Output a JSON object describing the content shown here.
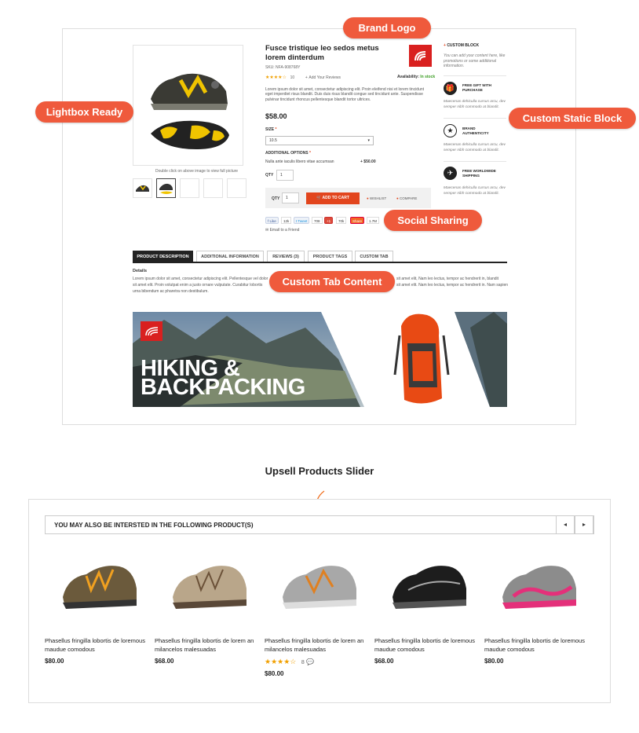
{
  "callouts": {
    "brand_logo": "Brand Logo",
    "lightbox": "Lightbox Ready",
    "static_block": "Custom Static Block",
    "social": "Social Sharing",
    "custom_tab": "Custom Tab Content",
    "upsell": "Upsell Products Slider"
  },
  "product": {
    "title": "Fusce tristique leo sedos metus lorem dinterdum",
    "sku": "SKU: NFA-908768Y",
    "rating_count": "10",
    "add_review": "Add Your Reviews",
    "availability_label": "Availability:",
    "availability": "In stock",
    "description": "Lorem ipsum dolor sit amet, consectetur adipiscing elit. Proin eleifend nisi et lorem tincidunt eget imperdiet risus blandit. Duis duis risus blandit congue sed tincidunt ante. Suspendisse pulvinar tincidunt rhoncus pellentesque blandit tortor ultrices.",
    "price": "$58.00",
    "size_label": "SIZE",
    "size_value": "10.5",
    "options_label": "ADDITIONAL OPTIONS",
    "option_text": "Nulla ante iaculis libero vitae accumsan",
    "option_price": "+ $50.00",
    "qty_label": "QTY",
    "qty_value": "1",
    "qty_value2": "1",
    "add_to_cart": "ADD TO CART",
    "wishlist": "WISHLIST",
    "compare": "COMPARE",
    "email_friend": "Email to a Friend",
    "image_note": "Double click on above image to view full picture"
  },
  "share": {
    "like": "Like",
    "like_count": "12k",
    "tweet": "Tweet",
    "tweet_count": "708",
    "gplus": "+1",
    "gplus_count": "70k",
    "sharebtn": "Share",
    "share_count": "1.7M"
  },
  "static_block": {
    "title": "CUSTOM BLOCK",
    "text": "You can add your content here, like promotions or some additional information.",
    "items": [
      {
        "title": "FREE GIFT WITH PURCHASE",
        "desc": "Maecenas dehiculla cursus arcu, dev semper nibh commodo at blandit."
      },
      {
        "title": "BRAND AUTHENTICITY",
        "desc": "Maecenas dehiculla cursus arcu, dev semper nibh commodo at blandit."
      },
      {
        "title": "FREE WORLDWIDE SHIPPING",
        "desc": "Maecenas dehiculla cursus arcu, dev semper nibh commodo at blandit."
      }
    ]
  },
  "tabs": [
    "PRODUCT DESCRIPTION",
    "ADDITIONAL INFORMATION",
    "REVIEWS (3)",
    "PRODUCT TAGS",
    "CUSTOM TAB"
  ],
  "tab_content": {
    "heading": "Details",
    "line1": "Lorem ipsum dolor sit amet, consectetur adipiscing elit. Pellentesque vel dolor",
    "line1b": "sit amet elit, Nam leo lectus, tempor ac hendrerit in, blandit",
    "line2": "sit amet elit. Proin volutpat enim a justo ornare vulputate. Curabitur lobortis",
    "line2b": "sit amet elit. Nam leo lectus, tempor ac hendrerit in. Nam sapien",
    "line3": "urna bibendum ac pharetra non destibulum."
  },
  "banner": {
    "line1": "HIKING &",
    "line2": "BACKPACKING"
  },
  "upsell": {
    "heading": "YOU MAY ALSO BE INTERSTED IN THE FOLLOWING PRODUCT(S)",
    "products": [
      {
        "name": "Phasellus fringilla lobortis de loremous maudue comodous",
        "price": "$80.00"
      },
      {
        "name": "Phasellus fringilla lobortis de lorem an milancelos malesuadas",
        "price": "$68.00"
      },
      {
        "name": "Phasellus fringilla lobortis de lorem an milancelos malesuadas",
        "price": "$80.00",
        "rating_count": "8"
      },
      {
        "name": "Phasellus fringilla lobortis de loremous maudue comodous",
        "price": "$68.00"
      },
      {
        "name": "Phasellus fringilla lobortis de loremous maudue comodous",
        "price": "$80.00"
      }
    ]
  },
  "colors": {
    "accent": "#ef5a3c",
    "cart": "#e2451d",
    "stock": "#3a9d23",
    "star": "#f1a000"
  }
}
